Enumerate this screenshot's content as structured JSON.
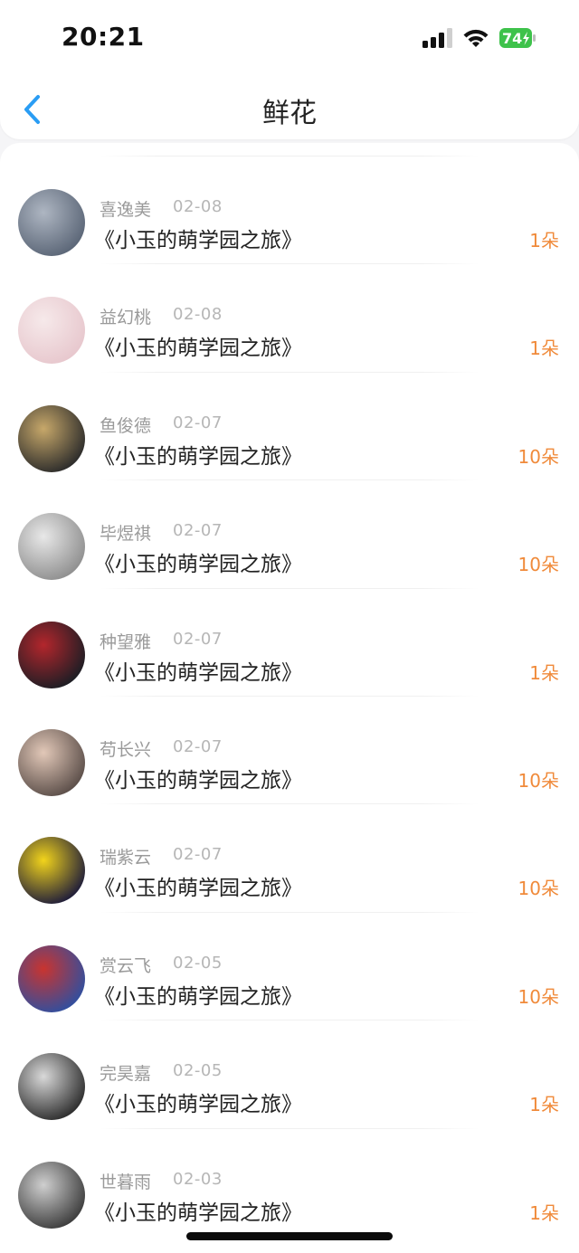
{
  "status": {
    "time": "20:21",
    "battery": "74"
  },
  "header": {
    "title": "鲜花"
  },
  "items": [
    {
      "name": "喜逸美",
      "date": "02-08",
      "book": "《小玉的萌学园之旅》",
      "amount": "1朵",
      "avatar_colors": [
        "#5a6576",
        "#aeb6c2"
      ]
    },
    {
      "name": "益幻桃",
      "date": "02-08",
      "book": "《小玉的萌学园之旅》",
      "amount": "1朵",
      "avatar_colors": [
        "#e7c7cd",
        "#f6e9ea"
      ]
    },
    {
      "name": "鱼俊德",
      "date": "02-07",
      "book": "《小玉的萌学园之旅》",
      "amount": "10朵",
      "avatar_colors": [
        "#2a2a2a",
        "#c7a86a"
      ]
    },
    {
      "name": "毕煜祺",
      "date": "02-07",
      "book": "《小玉的萌学园之旅》",
      "amount": "10朵",
      "avatar_colors": [
        "#8e8e8e",
        "#e8e8e8"
      ]
    },
    {
      "name": "种望雅",
      "date": "02-07",
      "book": "《小玉的萌学园之旅》",
      "amount": "1朵",
      "avatar_colors": [
        "#1a1d24",
        "#b3262c"
      ]
    },
    {
      "name": "苟长兴",
      "date": "02-07",
      "book": "《小玉的萌学园之旅》",
      "amount": "10朵",
      "avatar_colors": [
        "#5a4d48",
        "#e2c8b8"
      ]
    },
    {
      "name": "瑞紫云",
      "date": "02-07",
      "book": "《小玉的萌学园之旅》",
      "amount": "10朵",
      "avatar_colors": [
        "#1c1a3a",
        "#f2d41b"
      ]
    },
    {
      "name": "赏云飞",
      "date": "02-05",
      "book": "《小玉的萌学园之旅》",
      "amount": "10朵",
      "avatar_colors": [
        "#2f4fa0",
        "#c9342f"
      ]
    },
    {
      "name": "完昊嘉",
      "date": "02-05",
      "book": "《小玉的萌学园之旅》",
      "amount": "1朵",
      "avatar_colors": [
        "#2b2b2b",
        "#d9d9d9"
      ]
    },
    {
      "name": "世暮雨",
      "date": "02-03",
      "book": "《小玉的萌学园之旅》",
      "amount": "1朵",
      "avatar_colors": [
        "#3b3b3b",
        "#cfcfcf"
      ]
    }
  ],
  "colors": {
    "accent_back": "#2a9df4",
    "amount": "#f08a3a",
    "battery": "#3ec24b"
  }
}
